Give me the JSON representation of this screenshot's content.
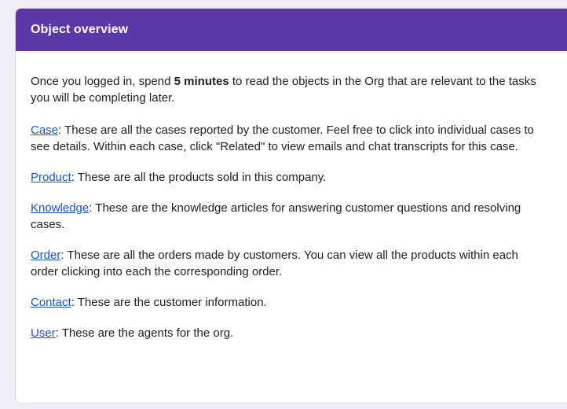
{
  "header": {
    "title": "Object overview"
  },
  "intro": {
    "before": "Once you logged in, spend ",
    "emphasis": "5 minutes",
    "after": " to read the objects in the Org that are relevant to the tasks you will be completing later."
  },
  "objects": [
    {
      "link": "Case",
      "desc": ": These are all the cases reported by the customer. Feel free to click into individual cases to see details. Within each case, click \"Related\" to view emails and chat transcripts for this case."
    },
    {
      "link": "Product",
      "desc": ": These are all the products sold in this company."
    },
    {
      "link": "Knowledge",
      "desc": ": These are the knowledge articles for answering customer questions and resolving cases."
    },
    {
      "link": "Order",
      "desc": ": These are all the orders made by customers. You can view all the products within each order clicking into each the corresponding order."
    },
    {
      "link": "Contact",
      "desc": ": These are the customer information."
    },
    {
      "link": "User",
      "desc": ": These are the agents for the org."
    }
  ],
  "colors": {
    "header_bg": "#5c37a8",
    "link": "#1a53c7",
    "page_bg": "#efedf6"
  }
}
